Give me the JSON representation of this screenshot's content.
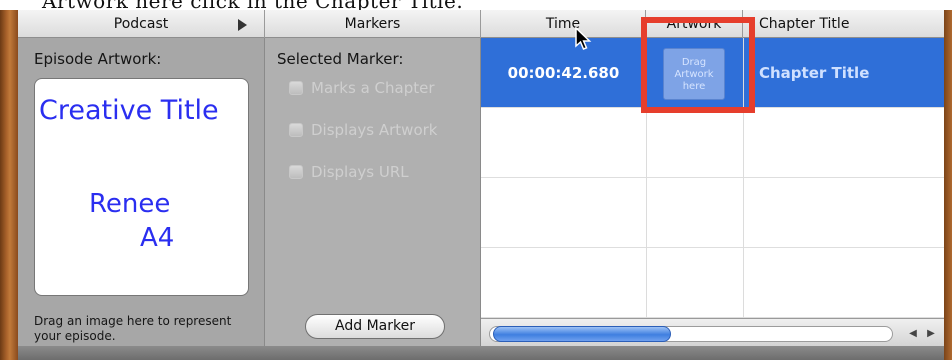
{
  "caption": "Artwork here click in the Chapter Title.",
  "header": {
    "podcast": "Podcast",
    "markers": "Markers",
    "time": "Time",
    "artwork": "Artwork",
    "chapter_title": "Chapter Title"
  },
  "podcast_pane": {
    "episode_artwork_label": "Episode Artwork:",
    "artwork_title": "Creative Title",
    "artwork_name_line1": "Renee",
    "artwork_name_line2": "A4",
    "drag_hint": "Drag an image here to represent your episode."
  },
  "markers_pane": {
    "selected_marker_label": "Selected Marker:",
    "checkboxes": [
      {
        "label": "Marks a Chapter",
        "checked": false
      },
      {
        "label": "Displays Artwork",
        "checked": false
      },
      {
        "label": "Displays URL",
        "checked": false
      }
    ],
    "add_marker_label": "Add Marker"
  },
  "table": {
    "rows": [
      {
        "time": "00:00:42.680",
        "artwork_drop": "Drag Artwork here",
        "chapter_title": "Chapter Title",
        "selected": true
      },
      {
        "time": "",
        "artwork_drop": "",
        "chapter_title": "",
        "selected": false
      },
      {
        "time": "",
        "artwork_drop": "",
        "chapter_title": "",
        "selected": false
      },
      {
        "time": "",
        "artwork_drop": "",
        "chapter_title": "",
        "selected": false
      }
    ]
  },
  "icons": {
    "disclosure": "triangle-right-icon",
    "cursor": "mouse-pointer-icon",
    "scroll_left": "arrow-left-icon",
    "scroll_right": "arrow-right-icon"
  },
  "colors": {
    "selection_blue": "#2f6fd8",
    "artwork_text_blue": "#2a2ef0",
    "highlight_red": "#e63e2c"
  }
}
